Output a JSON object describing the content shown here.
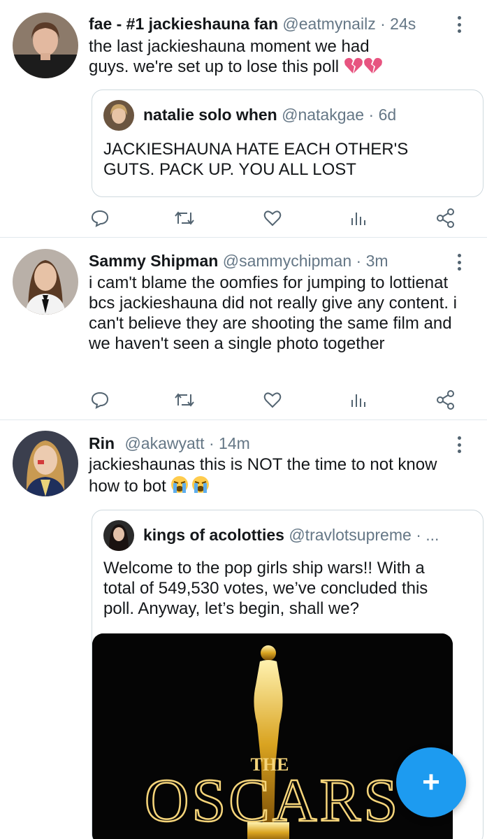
{
  "tweets": [
    {
      "name": "fae - #1 jackieshauna fan",
      "handle": "@eatmynailz",
      "dot": "·",
      "time": "24s",
      "text": "the last jackieshauna moment we had guys. we're set up to lose this poll",
      "emoji": "broken-heart-emoji",
      "quote": {
        "name": "natalie solo when",
        "handle": "@natakgae",
        "dot": "·",
        "time": "6d",
        "text": "JACKIESHAUNA HATE EACH OTHER'S GUTS. PACK UP. YOU ALL LOST"
      }
    },
    {
      "name": "Sammy Shipman",
      "handle": "@sammychipman",
      "dot": "·",
      "time": "3m",
      "text": "i cam't blame the oomfies for jumping to lottienat bcs jackieshauna did not really give any content. i can't believe they are shooting the same film and we haven't seen a single photo together"
    },
    {
      "name": "Rin",
      "handle": "@akawyatt",
      "dot": "·",
      "time": "14m",
      "text": "jackieshaunas this is NOT the time to not know how to bot",
      "emoji": "crying-face-emoji",
      "quote": {
        "name": "kings of acolotties",
        "handle": "@travlotsupreme",
        "dot": "· ...",
        "text": "Welcome to the pop girls ship wars!! With a total of 549,530 votes, we’ve concluded this poll. Anyway, let’s begin, shall we?",
        "image_text_top": "THE",
        "image_text_main": "OSCARS"
      }
    }
  ],
  "colors": {
    "accent": "#1d9bf0",
    "secondary_text": "#657786",
    "divider": "#e1e8ed"
  },
  "icons": [
    "reply-icon",
    "retweet-icon",
    "like-icon",
    "analytics-icon",
    "share-icon",
    "more-icon",
    "compose-icon"
  ],
  "fab": {
    "label": "+"
  }
}
